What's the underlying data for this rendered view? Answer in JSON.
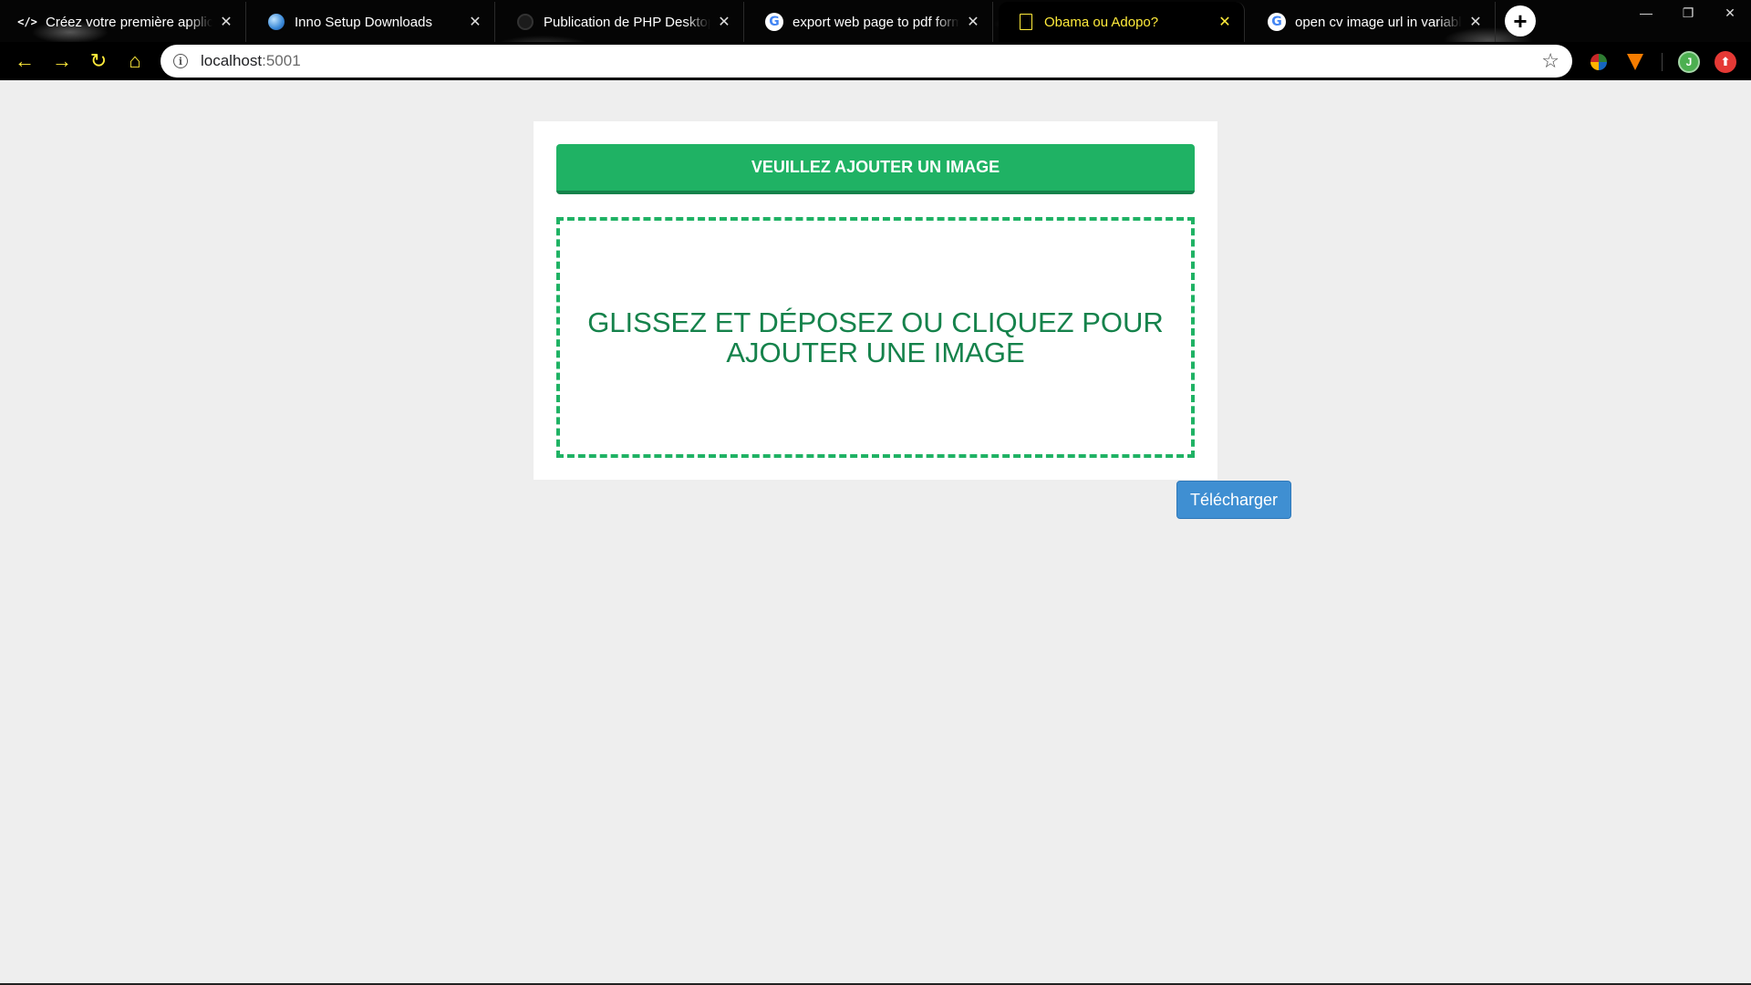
{
  "browser": {
    "tabs": [
      {
        "title": "Créez votre première applica",
        "favicon": "code-icon",
        "active": false
      },
      {
        "title": "Inno Setup Downloads",
        "favicon": "inno-setup-icon",
        "active": false
      },
      {
        "title": "Publication de PHP Desktop",
        "favicon": "github-icon",
        "active": false
      },
      {
        "title": "export web page to pdf form",
        "favicon": "google-icon",
        "active": false
      },
      {
        "title": "Obama ou Adopo?",
        "favicon": "document-icon",
        "active": true
      },
      {
        "title": "open cv image url in variable",
        "favicon": "google-icon",
        "active": false
      }
    ],
    "new_tab_label": "+",
    "address": {
      "host": "localhost",
      "port": ":5001"
    },
    "profile_initial": "J",
    "accent_color": "#ffeb3b"
  },
  "page": {
    "header_button_label": "VEUILLEZ AJOUTER UN IMAGE",
    "drop_zone_text": "Glissez et déposez ou cliquez pour ajouter une image",
    "download_button_label": "Télécharger",
    "colors": {
      "primary_green": "#1fb264",
      "dark_green": "#15824b",
      "download_blue": "#3f8fd2",
      "background": "#eeeeee"
    }
  }
}
